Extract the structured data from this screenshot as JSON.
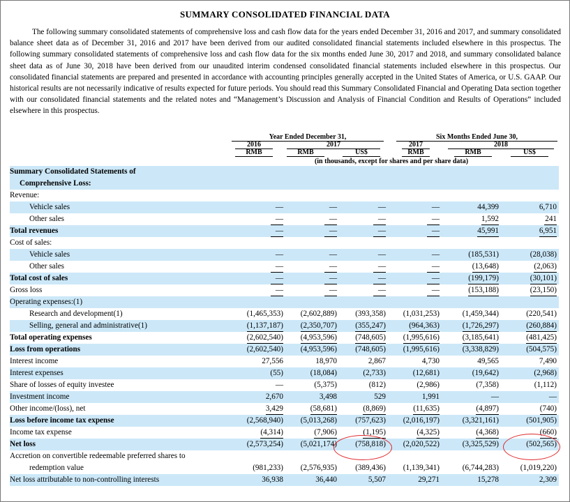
{
  "title": "SUMMARY CONSOLIDATED FINANCIAL DATA",
  "intro": "The following summary consolidated statements of comprehensive loss and cash flow data for the years ended December 31, 2016 and 2017, and summary consolidated balance sheet data as of December 31, 2016 and 2017 have been derived from our audited consolidated financial statements included elsewhere in this prospectus. The following summary consolidated statements of comprehensive loss and cash flow data for the six months ended June 30, 2017 and 2018, and summary consolidated balance sheet data as of June 30, 2018 have been derived from our unaudited interim condensed consolidated financial statements included elsewhere in this prospectus. Our consolidated financial statements are prepared and presented in accordance with accounting principles generally accepted in the United States of America, or U.S. GAAP. Our historical results are not necessarily indicative of results expected for future periods. You should read this Summary Consolidated Financial and Operating Data section together with our consolidated financial statements and the related notes and “Management’s Discussion and Analysis of Financial Condition and Results of Operations” included elsewhere in this prospectus.",
  "header": {
    "year_group": "Year Ended December 31,",
    "six_group": "Six Months Ended June 30,",
    "y2016": "2016",
    "y2017": "2017",
    "s2017": "2017",
    "s2018": "2018",
    "cur_rmb": "RMB",
    "cur_usd": "US$",
    "note": "(in thousands, except for shares and per share data)"
  },
  "rows": [
    {
      "label": "Summary Consolidated Statements of",
      "style": "section",
      "shade": true,
      "values": []
    },
    {
      "label": "Comprehensive Loss:",
      "style": "section2",
      "shade": true,
      "values": []
    },
    {
      "label": "Revenue:",
      "style": "plain",
      "shade": false,
      "values": []
    },
    {
      "label": "Vehicle sales",
      "style": "indent",
      "shade": true,
      "values": [
        "—",
        "—",
        "—",
        "—",
        "44,399",
        "6,710"
      ]
    },
    {
      "label": "Other sales",
      "style": "indent",
      "shade": false,
      "values": [
        "—",
        "—",
        "—",
        "—",
        "1,592",
        "241"
      ],
      "u": true
    },
    {
      "label": "Total revenues",
      "style": "bold",
      "shade": true,
      "values": [
        "—",
        "—",
        "—",
        "—",
        "45,991",
        "6,951"
      ],
      "u": true
    },
    {
      "label": "Cost of sales:",
      "style": "plain",
      "shade": false,
      "values": []
    },
    {
      "label": "Vehicle sales",
      "style": "indent",
      "shade": true,
      "values": [
        "—",
        "—",
        "—",
        "—",
        "(185,531)",
        "(28,038)"
      ]
    },
    {
      "label": "Other sales",
      "style": "indent",
      "shade": false,
      "values": [
        "—",
        "—",
        "—",
        "—",
        "(13,648)",
        "(2,063)"
      ],
      "u": true
    },
    {
      "label": "Total cost of sales",
      "style": "bold",
      "shade": true,
      "values": [
        "—",
        "—",
        "—",
        "—",
        "(199,179)",
        "(30,101)"
      ],
      "u": true
    },
    {
      "label": "Gross loss",
      "style": "plain",
      "shade": false,
      "values": [
        "—",
        "—",
        "—",
        "—",
        "(153,188)",
        "(23,150)"
      ],
      "u": true
    },
    {
      "label": "Operating expenses:(1)",
      "style": "plain",
      "shade": true,
      "values": []
    },
    {
      "label": "Research and development(1)",
      "style": "indent",
      "shade": false,
      "values": [
        "(1,465,353)",
        "(2,602,889)",
        "(393,358)",
        "(1,031,253)",
        "(1,459,344)",
        "(220,541)"
      ]
    },
    {
      "label": "Selling, general and administrative(1)",
      "style": "indent",
      "shade": true,
      "values": [
        "(1,137,187)",
        "(2,350,707)",
        "(355,247)",
        "(964,363)",
        "(1,726,297)",
        "(260,884)"
      ],
      "u": true
    },
    {
      "label": "Total operating expenses",
      "style": "bold",
      "shade": false,
      "values": [
        "(2,602,540)",
        "(4,953,596)",
        "(748,605)",
        "(1,995,616)",
        "(3,185,641)",
        "(481,425)"
      ],
      "u": true
    },
    {
      "label": "Loss from operations",
      "style": "bold",
      "shade": true,
      "values": [
        "(2,602,540)",
        "(4,953,596)",
        "(748,605)",
        "(1,995,616)",
        "(3,338,829)",
        "(504,575)"
      ]
    },
    {
      "label": "Interest income",
      "style": "plain",
      "shade": false,
      "values": [
        "27,556",
        "18,970",
        "2,867",
        "4,730",
        "49,565",
        "7,490"
      ]
    },
    {
      "label": "Interest expenses",
      "style": "plain",
      "shade": true,
      "values": [
        "(55)",
        "(18,084)",
        "(2,733)",
        "(12,681)",
        "(19,642)",
        "(2,968)"
      ]
    },
    {
      "label": "Share of losses of equity investee",
      "style": "plain",
      "shade": false,
      "values": [
        "—",
        "(5,375)",
        "(812)",
        "(2,986)",
        "(7,358)",
        "(1,112)"
      ]
    },
    {
      "label": "Investment income",
      "style": "plain",
      "shade": true,
      "values": [
        "2,670",
        "3,498",
        "529",
        "1,991",
        "—",
        "—"
      ]
    },
    {
      "label": "Other income/(loss), net",
      "style": "plain",
      "shade": false,
      "values": [
        "3,429",
        "(58,681)",
        "(8,869)",
        "(11,635)",
        "(4,897)",
        "(740)"
      ],
      "u": true
    },
    {
      "label": "Loss before income tax expense",
      "style": "bold",
      "shade": true,
      "values": [
        "(2,568,940)",
        "(5,013,268)",
        "(757,623)",
        "(2,016,197)",
        "(3,321,161)",
        "(501,905)"
      ]
    },
    {
      "label": "Income tax expense",
      "style": "plain",
      "shade": false,
      "values": [
        "(4,314)",
        "(7,906)",
        "(1,195)",
        "(4,325)",
        "(4,368)",
        "(660)"
      ],
      "u": true
    },
    {
      "label": "Net loss",
      "style": "bold",
      "shade": true,
      "values": [
        "(2,573,254)",
        "(5,021,174)",
        "(758,818)",
        "(2,020,522)",
        "(3,325,529)",
        "(502,565)"
      ]
    },
    {
      "label": "Accretion on convertible redeemable preferred shares to",
      "style": "plain",
      "shade": false,
      "values": []
    },
    {
      "label": "redemption value",
      "style": "indent",
      "shade": false,
      "values": [
        "(981,233)",
        "(2,576,935)",
        "(389,436)",
        "(1,139,341)",
        "(6,744,283)",
        "(1,019,220)"
      ]
    },
    {
      "label": "Net loss attributable to non-controlling interests",
      "style": "plain",
      "shade": true,
      "values": [
        "36,938",
        "36,440",
        "5,507",
        "29,271",
        "15,278",
        "2,309"
      ]
    }
  ],
  "annotations": {
    "color": "#e0262a",
    "circled": [
      "net-loss-2017-usd",
      "net-loss-2018-usd"
    ]
  }
}
